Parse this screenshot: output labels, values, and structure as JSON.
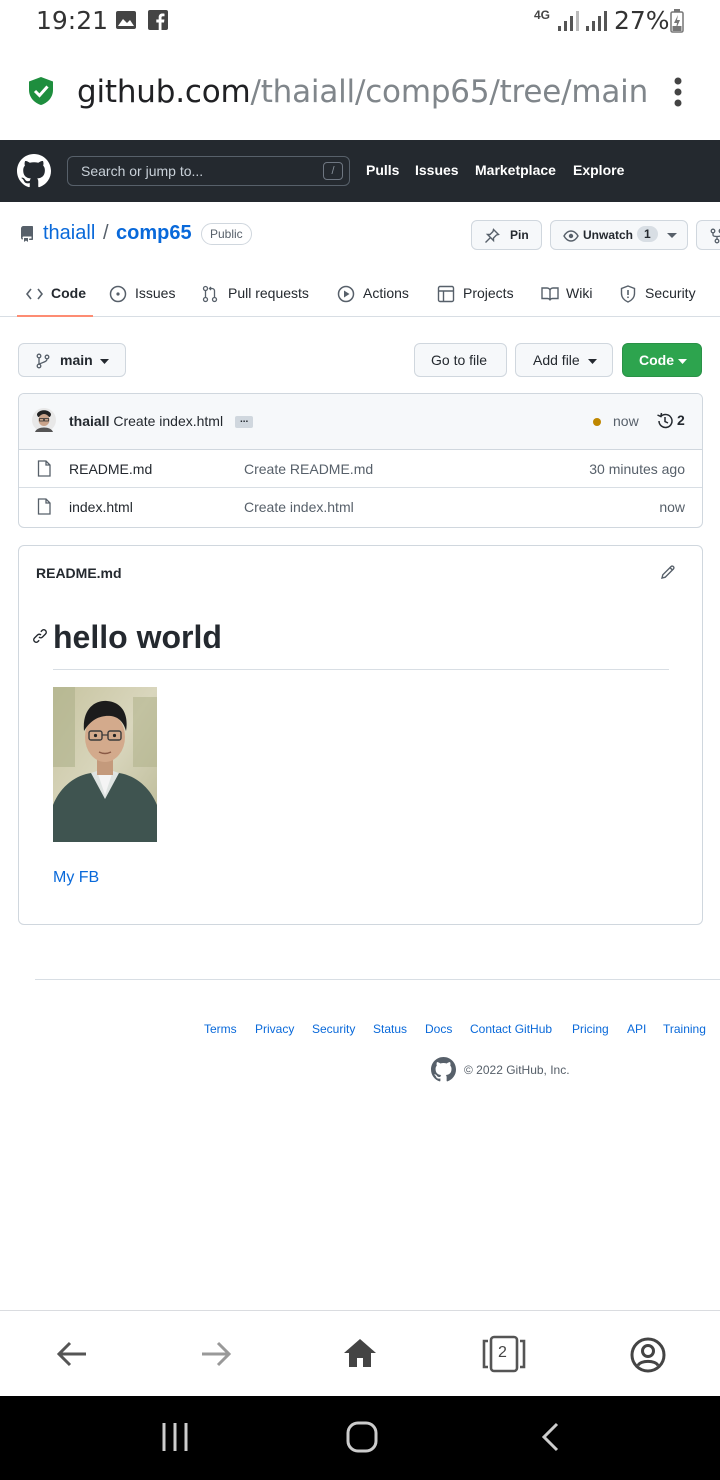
{
  "status_bar": {
    "time": "19:21",
    "network": "4G",
    "battery": "27%",
    "icons": [
      "gallery-icon",
      "facebook-icon",
      "signal-icon",
      "battery-icon"
    ]
  },
  "browser": {
    "url_domain": "github.com",
    "url_path": "/thaiall/comp65/tree/main",
    "tab_count": "2"
  },
  "github_header": {
    "search_placeholder": "Search or jump to...",
    "search_shortcut": "/",
    "nav": [
      "Pulls",
      "Issues",
      "Marketplace",
      "Explore"
    ]
  },
  "repo": {
    "owner": "thaiall",
    "separator": "/",
    "name": "comp65",
    "visibility": "Public",
    "pin_label": "Pin",
    "watch_label": "Unwatch",
    "watch_count": "1"
  },
  "tabs": [
    {
      "label": "Code",
      "active": true
    },
    {
      "label": "Issues"
    },
    {
      "label": "Pull requests"
    },
    {
      "label": "Actions"
    },
    {
      "label": "Projects"
    },
    {
      "label": "Wiki"
    },
    {
      "label": "Security"
    }
  ],
  "toolbar": {
    "branch": "main",
    "go_to_file": "Go to file",
    "add_file": "Add file",
    "code": "Code"
  },
  "latest_commit": {
    "author": "thaiall",
    "message": "Create index.html",
    "ellipsis": "...",
    "time": "now",
    "commit_count": "2"
  },
  "files": [
    {
      "name": "README.md",
      "message": "Create README.md",
      "age": "30 minutes ago"
    },
    {
      "name": "index.html",
      "message": "Create index.html",
      "age": "now"
    }
  ],
  "readme": {
    "title": "README.md",
    "heading": "hello world",
    "link": "My FB"
  },
  "footer": {
    "links": [
      "Terms",
      "Privacy",
      "Security",
      "Status",
      "Docs",
      "Contact GitHub",
      "Pricing",
      "API",
      "Training"
    ],
    "copyright": "© 2022 GitHub, Inc."
  },
  "colors": {
    "accent_link": "#0969da",
    "code_button": "#2da44e",
    "header_bg": "#24292f",
    "active_tab": "#fd8c73",
    "secure_shield": "#1e8e3e"
  }
}
